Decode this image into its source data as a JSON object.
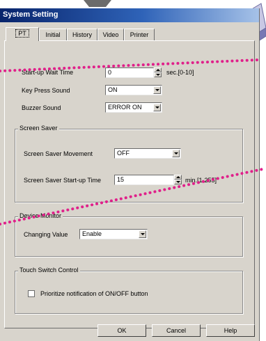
{
  "window": {
    "title": "System Setting"
  },
  "tabs": [
    {
      "label": "PT"
    },
    {
      "label": "Initial"
    },
    {
      "label": "History"
    },
    {
      "label": "Video"
    },
    {
      "label": "Printer"
    }
  ],
  "startup_wait": {
    "label": "Start-up Wait Time",
    "value": "0",
    "unit": "sec.[0-10]"
  },
  "key_press": {
    "label": "Key Press Sound",
    "value": "ON"
  },
  "buzzer": {
    "label": "Buzzer Sound",
    "value": "ERROR ON"
  },
  "screen_saver": {
    "group_title": "Screen Saver",
    "movement_label": "Screen Saver Movement",
    "movement_value": "OFF",
    "startup_label": "Screen Saver Start-up Time",
    "startup_value": "15",
    "startup_unit": "min.[1-255]"
  },
  "device_monitor": {
    "group_title": "Device Monitor",
    "changing_label": "Changing Value",
    "changing_value": "Enable"
  },
  "touch_switch": {
    "group_title": "Touch Switch Control",
    "checkbox_label": "Prioritize notification of ON/OFF button",
    "checked": false
  },
  "buttons": {
    "ok": "OK",
    "cancel": "Cancel",
    "help": "Help"
  },
  "colors": {
    "titlebar": "#08246b",
    "dialog_bg": "#d8d4cc",
    "annotation_dots": "#e0208a",
    "decoration": "#8a8ac0"
  }
}
